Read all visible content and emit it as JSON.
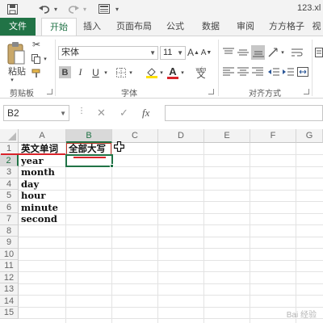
{
  "window": {
    "title": "123.xl"
  },
  "quick_access": {
    "save_icon": "save-icon",
    "undo_icon": "undo-icon",
    "redo_icon": "redo-icon",
    "customize_icon": "form-icon"
  },
  "tabs": [
    {
      "label": "文件"
    },
    {
      "label": "开始",
      "active": true
    },
    {
      "label": "插入"
    },
    {
      "label": "页面布局"
    },
    {
      "label": "公式"
    },
    {
      "label": "数据"
    },
    {
      "label": "审阅"
    },
    {
      "label": "方方格子"
    },
    {
      "label": "视"
    }
  ],
  "ribbon": {
    "clipboard": {
      "group_label": "剪贴板",
      "paste_label": "粘贴"
    },
    "font": {
      "group_label": "字体",
      "font_name": "宋体",
      "font_size": "11",
      "bold": "B",
      "italic": "I",
      "underline": "U",
      "font_color_glyph": "A",
      "wen_glyph": "wén"
    },
    "alignment": {
      "group_label": "对齐方式"
    }
  },
  "formula_bar": {
    "cell_ref": "B2",
    "cancel": "✕",
    "enter": "✓",
    "fx": "fx",
    "value": ""
  },
  "grid": {
    "columns": [
      "A",
      "B",
      "C",
      "D",
      "E",
      "F",
      "G"
    ],
    "rows": [
      "1",
      "2",
      "3",
      "4",
      "5",
      "6",
      "7",
      "8",
      "9",
      "10",
      "11",
      "12",
      "13",
      "14",
      "15"
    ],
    "cells": {
      "A1": "英文单词",
      "B1": "全部大写",
      "A2": "year",
      "A3": "month",
      "A4": "day",
      "A5": "hour",
      "A6": "minute",
      "A7": "second"
    },
    "selected_cell": "B2"
  },
  "watermark": "Bai 经验"
}
